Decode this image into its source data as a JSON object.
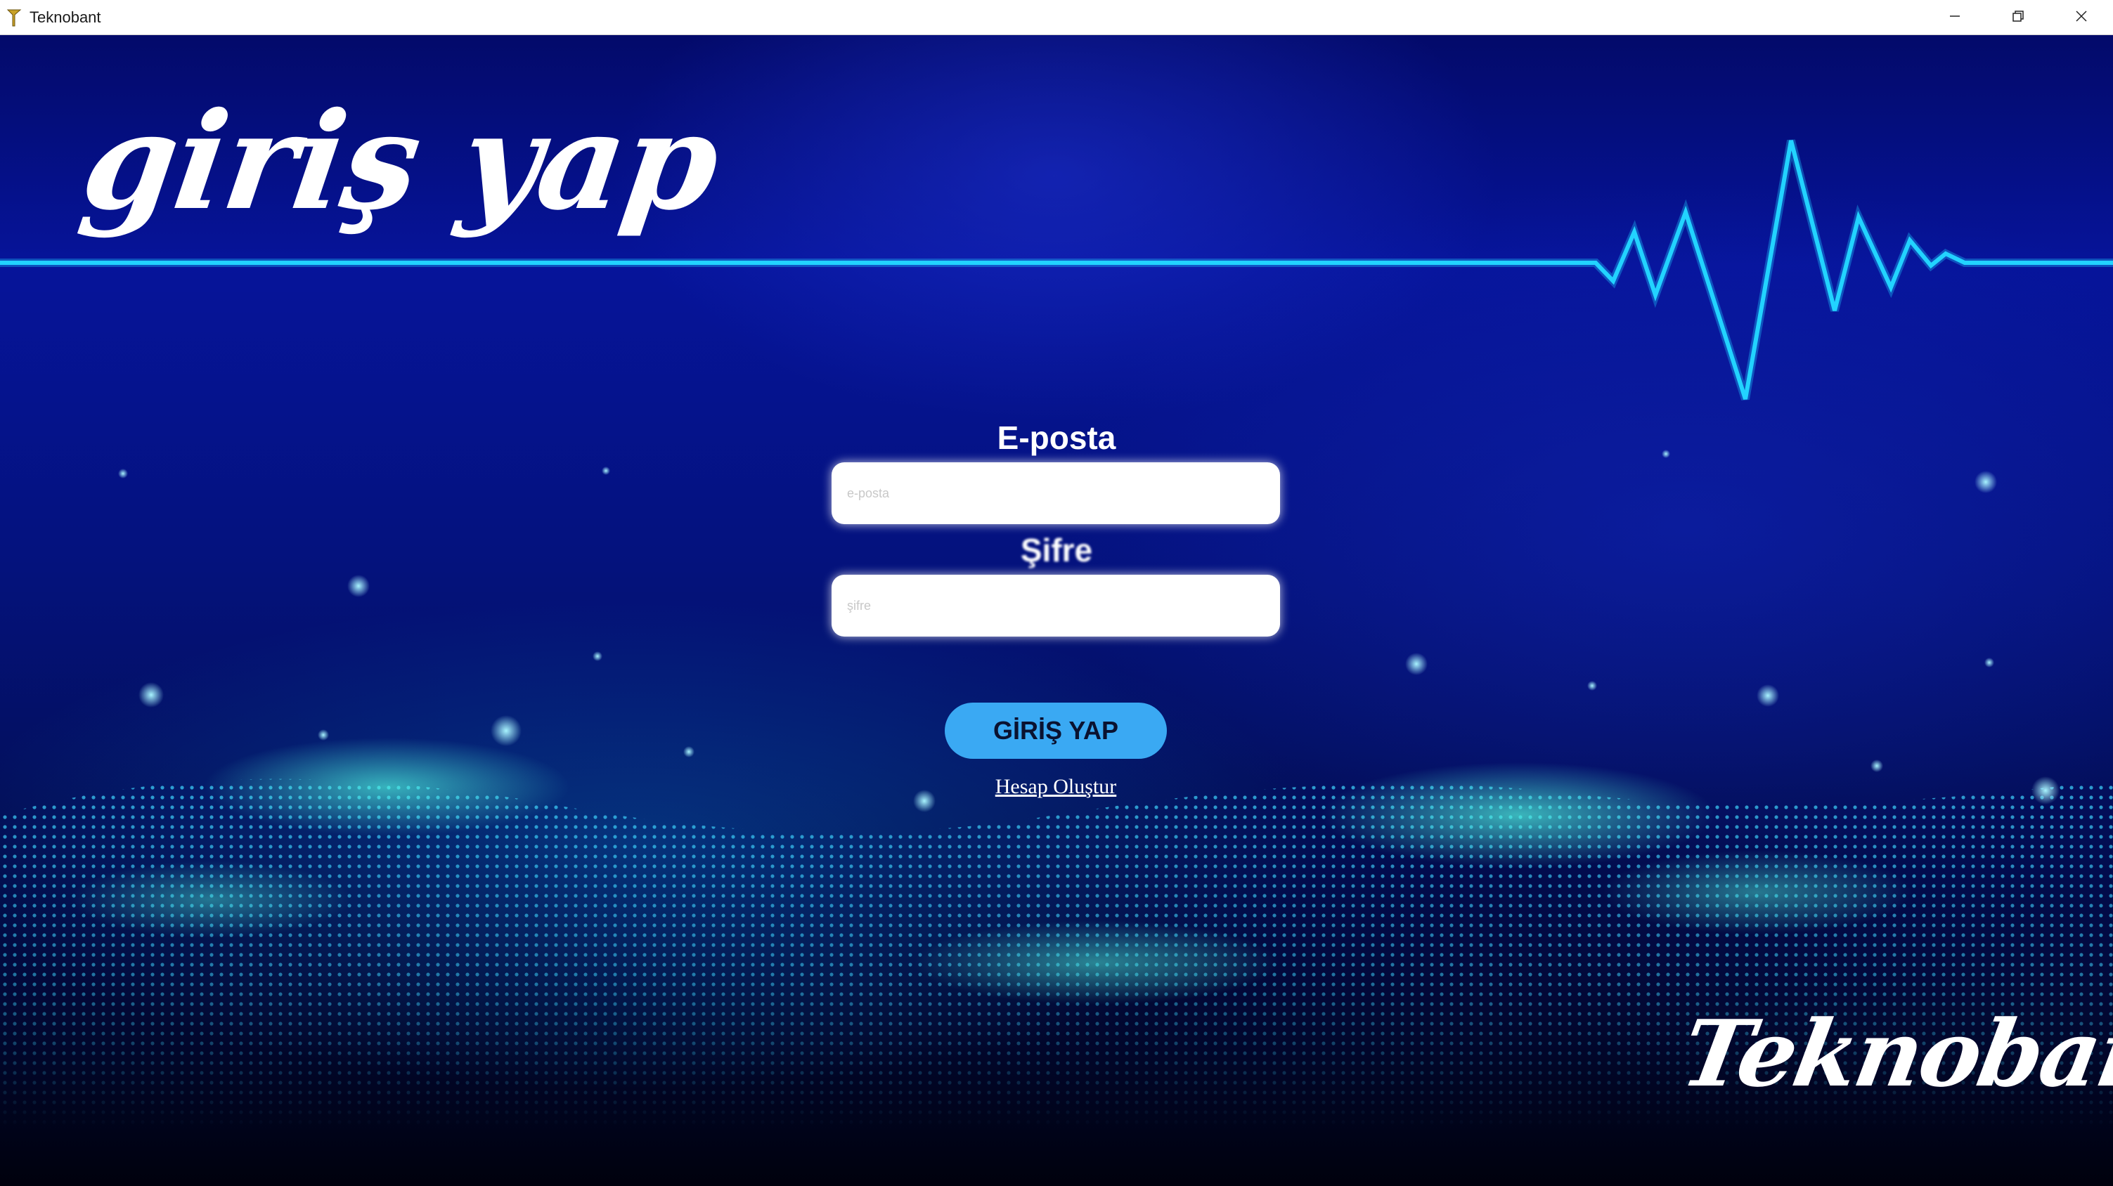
{
  "window": {
    "title": "Teknobant",
    "controls": {
      "minimize_icon": "minimize-icon",
      "maximize_icon": "restore-icon",
      "close_icon": "close-icon"
    }
  },
  "header": {
    "title": "giriş yap"
  },
  "form": {
    "email": {
      "label": "E-posta",
      "placeholder": "e-posta",
      "value": ""
    },
    "password": {
      "label": "Şifre",
      "placeholder": "şifre",
      "value": ""
    },
    "submit_label": "GİRİŞ YAP",
    "create_account_label": "Hesap Oluştur"
  },
  "brand": {
    "logo_text": "Teknobant"
  },
  "colors": {
    "background_top": "#06149a",
    "background_bottom": "#00010d",
    "accent_cyan": "#1ec8ff",
    "button_blue": "#3aa9f3",
    "text_white": "#ffffff"
  }
}
